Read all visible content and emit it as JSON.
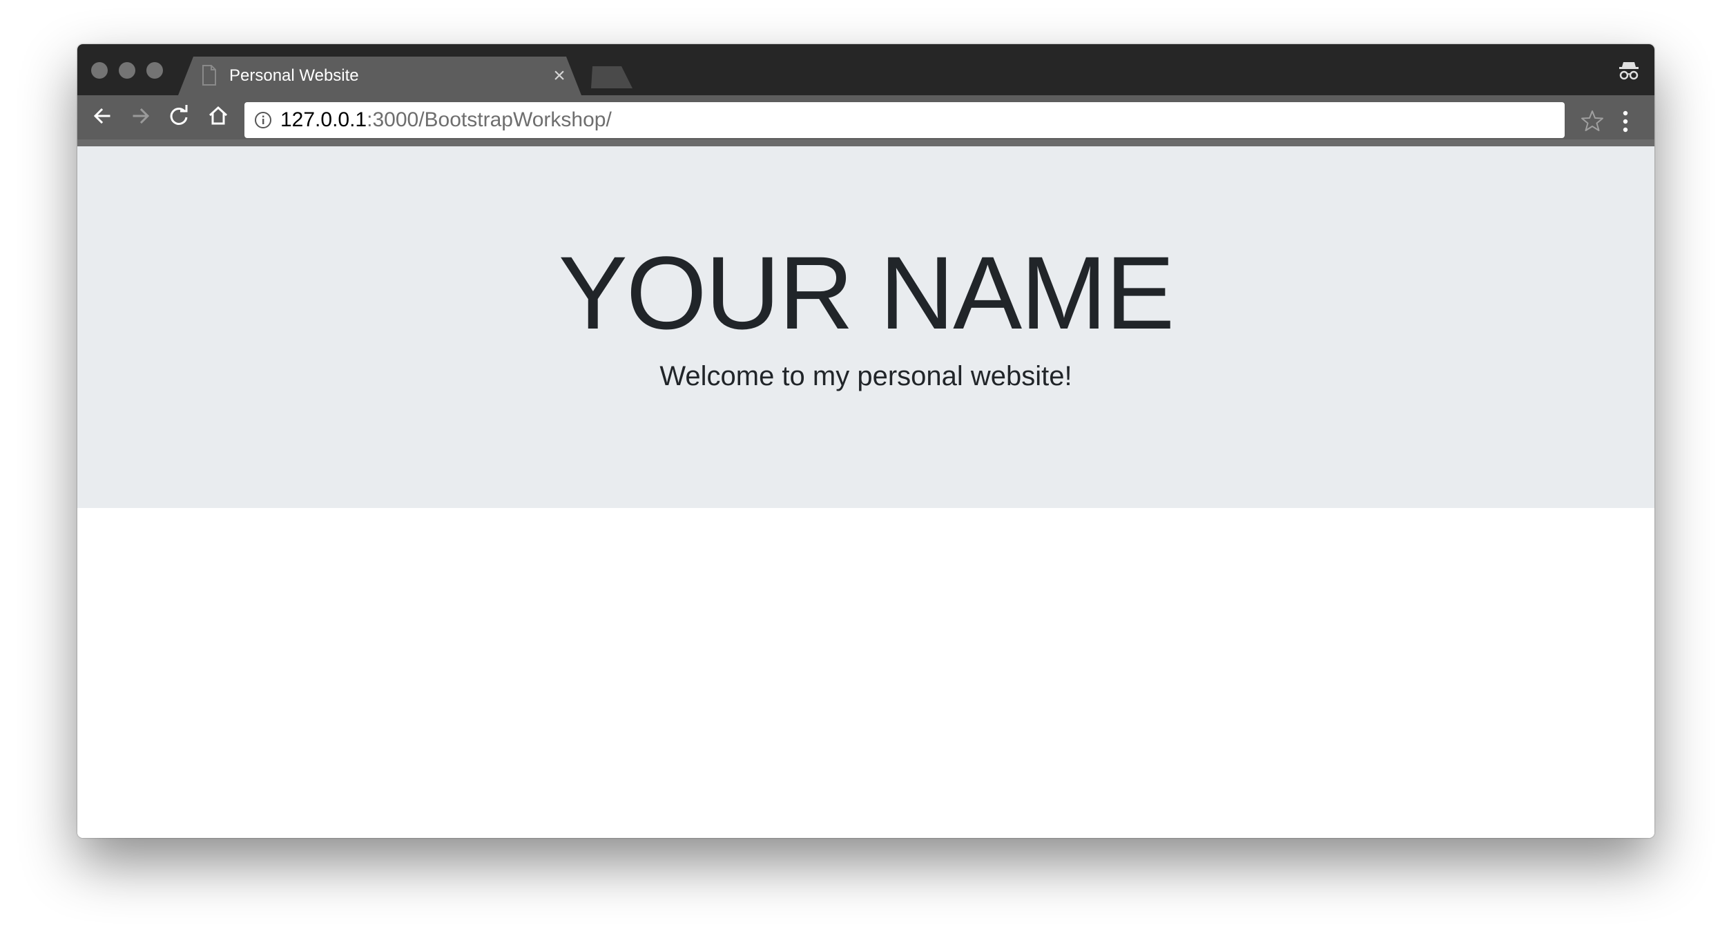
{
  "browser": {
    "tab": {
      "title": "Personal Website",
      "close_glyph": "×",
      "icon": "page-icon"
    },
    "address_bar": {
      "host": "127.0.0.1",
      "path": ":3000/BootstrapWorkshop/",
      "icon": "info-icon"
    },
    "toolbar_icons": [
      "back-arrow-icon",
      "forward-arrow-icon",
      "reload-icon",
      "home-icon",
      "star-icon",
      "menu-kebab-icon",
      "incognito-icon"
    ]
  },
  "page": {
    "jumbotron": {
      "title": "YOUR NAME",
      "lead": "Welcome to my personal website!"
    }
  },
  "colors": {
    "titlebar": "#262626",
    "toolbar": "#5d5d5d",
    "jumbotron_bg": "#e9ecef",
    "text": "#212529"
  }
}
